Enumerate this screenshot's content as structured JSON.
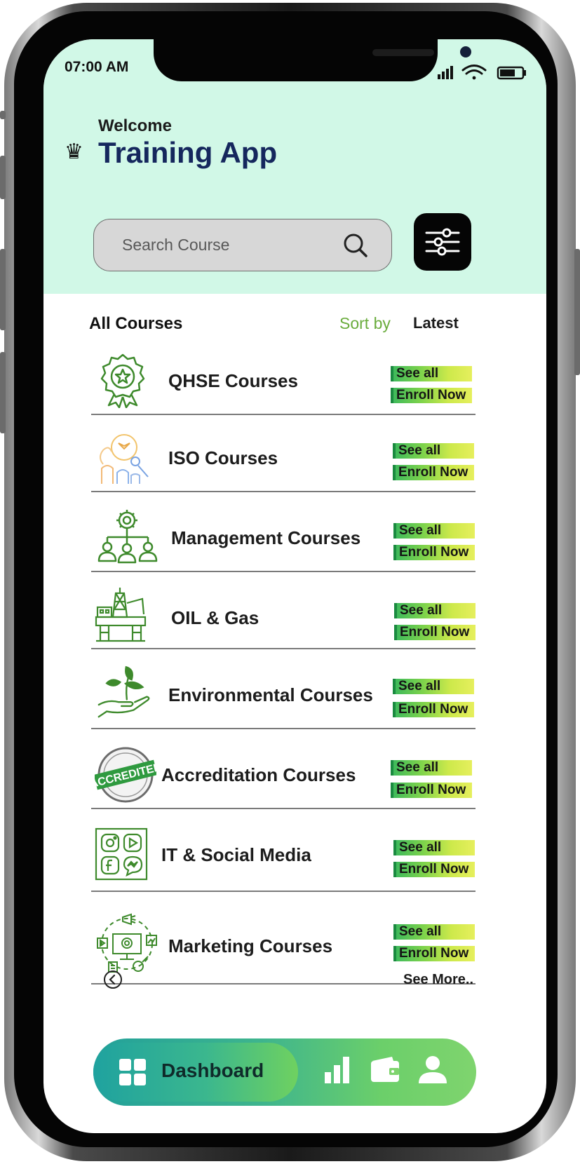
{
  "status_bar": {
    "time": "07:00 AM"
  },
  "header": {
    "welcome": "Welcome",
    "title": "Training App"
  },
  "search": {
    "placeholder": "Search Course"
  },
  "list": {
    "heading": "All Courses",
    "sort_label": "Sort by",
    "sort_value": "Latest"
  },
  "courses": [
    {
      "title": "QHSE Courses",
      "icon": "award-badge-icon"
    },
    {
      "title": "ISO Courses",
      "icon": "iso-people-icon"
    },
    {
      "title": "Management Courses",
      "icon": "team-hierarchy-icon"
    },
    {
      "title": "OIL & Gas",
      "icon": "oil-rig-icon"
    },
    {
      "title": "Environmental Courses",
      "icon": "plant-in-hand-icon"
    },
    {
      "title": "Accreditation Courses",
      "icon": "accredited-stamp-icon"
    },
    {
      "title": "IT & Social Media",
      "icon": "social-media-grid-icon"
    },
    {
      "title": "Marketing Courses",
      "icon": "marketing-monitor-icon"
    }
  ],
  "actions": {
    "see_all": "See all",
    "enroll": "Enroll Now"
  },
  "footer": {
    "see_more": "See More.."
  },
  "nav": {
    "dashboard": "Dashboard"
  },
  "colors": {
    "header_bg": "#d1f8e7",
    "title": "#15275d",
    "accent_green": "#6aac3d"
  }
}
